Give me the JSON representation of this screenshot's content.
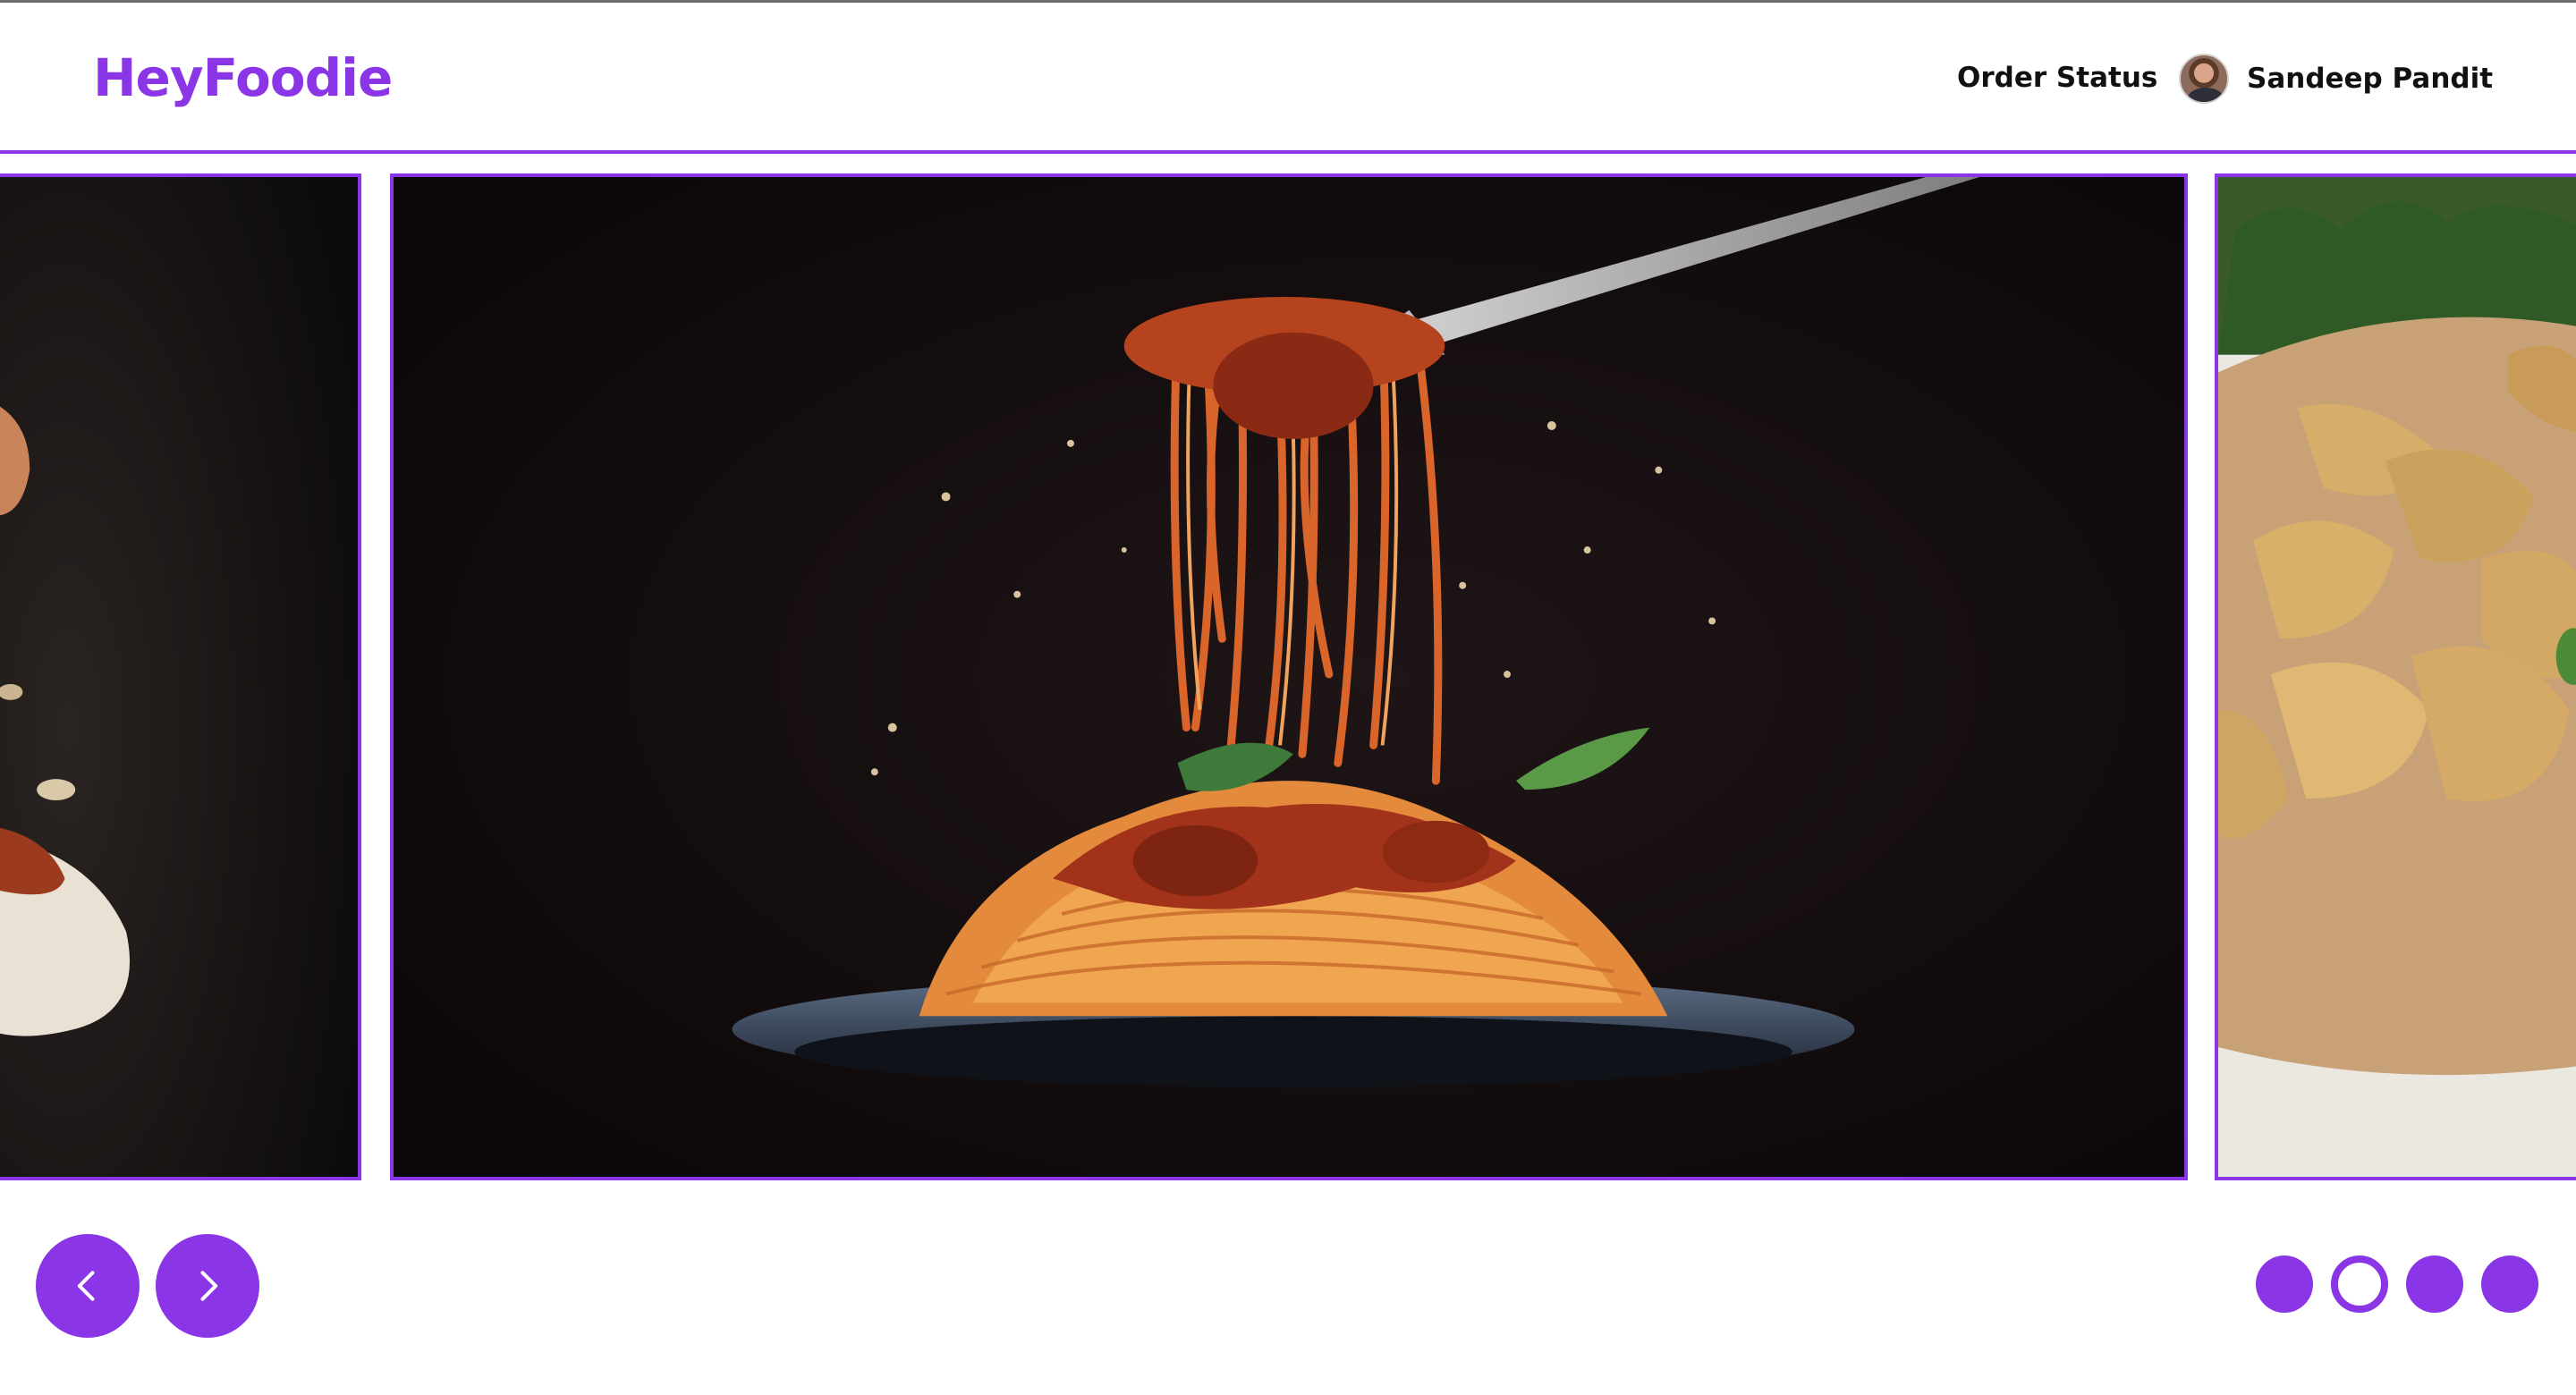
{
  "brand": {
    "name": "HeyFoodie",
    "accent": "#8a36e6"
  },
  "header": {
    "order_status_label": "Order Status",
    "user_name": "Sandeep Pandit"
  },
  "carousel": {
    "slides": [
      {
        "subject": "dumplings-with-sauce",
        "position": "previous"
      },
      {
        "subject": "spaghetti-on-fork",
        "position": "current"
      },
      {
        "subject": "samosas",
        "position": "next"
      }
    ],
    "prev_icon": "chevron-left-icon",
    "next_icon": "chevron-right-icon",
    "indicator_count": 4,
    "active_indicator": 2
  }
}
